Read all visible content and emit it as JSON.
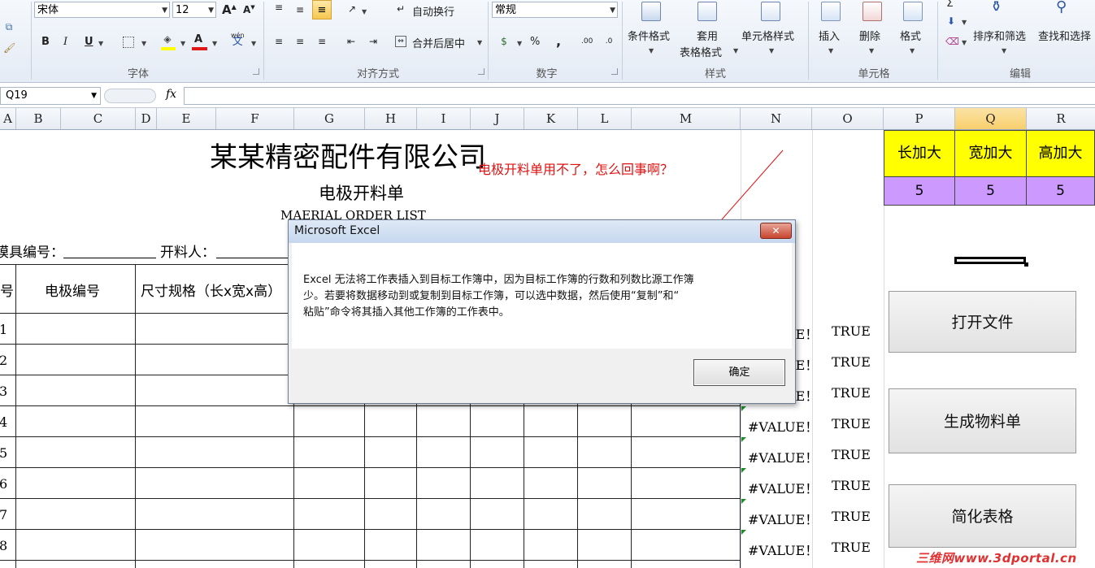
{
  "ribbon": {
    "font_name": "宋体",
    "font_size": "12",
    "grow_font": "A",
    "shrink_font": "A",
    "bold": "B",
    "italic": "I",
    "underline": "U",
    "phonetic": "wén",
    "phonetic_char": "文",
    "wrap_text": "自动换行",
    "merge_center": "合并后居中",
    "number_format": "常规",
    "percent": "%",
    "comma": ",",
    "conditional_format": "条件格式",
    "table_format_1": "套用",
    "table_format_2": "表格格式",
    "cell_styles": "单元格样式",
    "insert": "插入",
    "delete": "删除",
    "format": "格式",
    "sort_filter": "排序和筛选",
    "find_select": "查找和选择",
    "sum_symbol": "Σ",
    "groups": {
      "font": "字体",
      "alignment": "对齐方式",
      "number": "数字",
      "styles": "样式",
      "cells": "单元格",
      "editing": "编辑"
    }
  },
  "formula_bar": {
    "name_box": "Q19",
    "fx": "fx",
    "formula": ""
  },
  "columns": [
    "A",
    "B",
    "C",
    "D",
    "E",
    "F",
    "G",
    "H",
    "I",
    "J",
    "K",
    "L",
    "M",
    "N",
    "O",
    "P",
    "Q",
    "R"
  ],
  "selected_column": "Q",
  "sheet": {
    "company": "某某精密配件有限公司",
    "doc_title": "电极开料单",
    "doc_subtitle": "MAERIAL ORDER LIST",
    "mold_no_label": "模具编号：",
    "operator_label": "开料人：",
    "header_no": "号",
    "header_electrode": "电极编号",
    "header_size": "尺寸规格（长x宽x高）",
    "row_numbers": [
      "1",
      "2",
      "3",
      "4",
      "5",
      "6",
      "7",
      "8"
    ],
    "value_error": "#VALUE！",
    "true_text": "TRUE",
    "note": "电极开料单用不了，怎么回事啊？",
    "extra": {
      "headers": [
        "长加大",
        "宽加大",
        "高加大"
      ],
      "values": [
        "5",
        "5",
        "5"
      ]
    },
    "buttons": {
      "open_file": "打开文件",
      "generate_bom": "生成物料单",
      "simplify": "简化表格"
    }
  },
  "dialog": {
    "title": "Microsoft Excel",
    "message_line1": "Excel 无法将工作表插入到目标工作簿中，因为目标工作簿的行数和列数比源工作簿",
    "message_line2": "少。若要将数据移动到或复制到目标工作簿，可以选中数据，然后使用“复制”和“",
    "message_line3": "粘贴”命令将其插入其他工作簿的工作表中。",
    "ok": "确定",
    "close": "✕"
  },
  "watermark": "三维网www.3dportal.cn",
  "colors": {
    "note_red": "#e01010",
    "extra_yellow": "#ffff00",
    "extra_purple": "#cc99ff",
    "selected_header": "#f8cf6d"
  }
}
